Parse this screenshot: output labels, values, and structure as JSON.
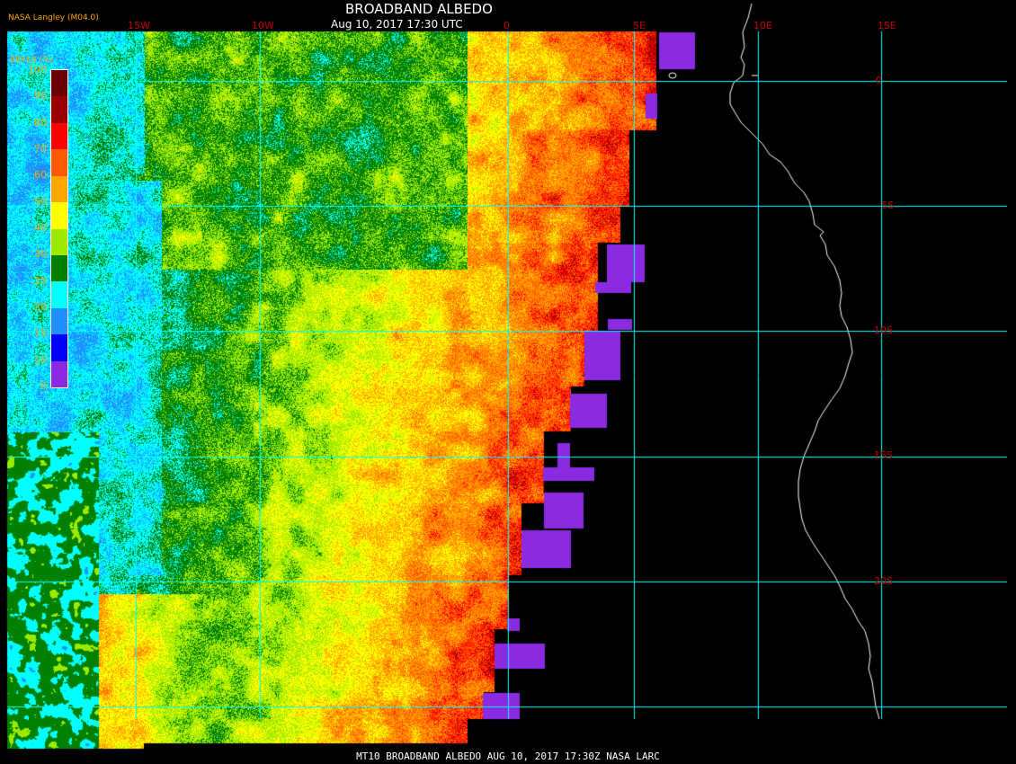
{
  "title": "BROADBAND ALBEDO",
  "subtitle": "Aug 10, 2017 17:30 UTC",
  "source": "NASA Langley (M04.0)",
  "footer": "MT10  BROADBAND ALBEDO   AUG 10, 2017 17:30Z   NASA LARC",
  "legend": {
    "label": "BBALB (%)",
    "ticks": [
      "100",
      "90",
      "80",
      "70",
      "60",
      "50",
      "40",
      "30",
      "25",
      "20",
      "15",
      "10",
      "0"
    ],
    "colors": [
      "#6b0000",
      "#9b0000",
      "#ff0000",
      "#ff5a00",
      "#ffa500",
      "#ffff00",
      "#9bea00",
      "#008000",
      "#00ffff",
      "#1e90ff",
      "#0000ff",
      "#8a2be2"
    ]
  },
  "lon_labels": [
    "15W",
    "10W",
    "0",
    "5E",
    "10E",
    "15E"
  ],
  "lat_labels": [
    "0",
    "5S",
    "10S",
    "15S",
    "20S"
  ],
  "colors": {
    "grid": "#00ffff",
    "coastline": "#ffffff",
    "label_red": "#c00000",
    "label_orange": "#ffa500",
    "nodata": "#8a2be2"
  }
}
